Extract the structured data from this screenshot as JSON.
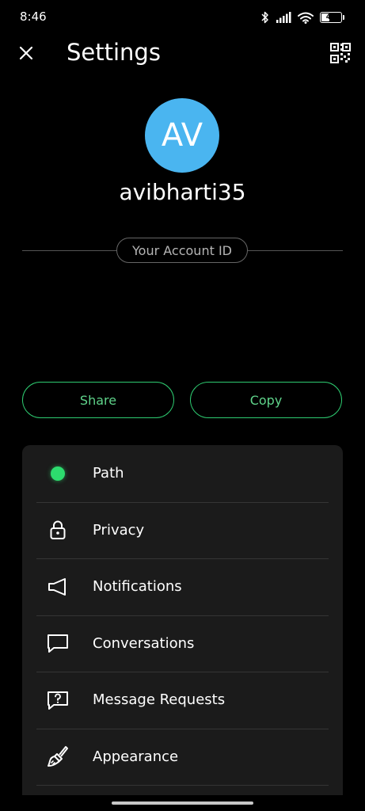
{
  "status_bar": {
    "time": "8:46",
    "battery": "43",
    "battery_level": 0.43
  },
  "header": {
    "title": "Settings"
  },
  "profile": {
    "initials": "AV",
    "username": "avibharti35",
    "account_id_label": "Your Account ID",
    "avatar_color": "#4ab5f0"
  },
  "actions": {
    "share_label": "Share",
    "copy_label": "Copy",
    "accent_color": "#2ecc71"
  },
  "menu": {
    "items": [
      {
        "label": "Path",
        "icon": "status-dot-icon"
      },
      {
        "label": "Privacy",
        "icon": "lock-icon"
      },
      {
        "label": "Notifications",
        "icon": "speaker-icon"
      },
      {
        "label": "Conversations",
        "icon": "chat-bubble-icon"
      },
      {
        "label": "Message Requests",
        "icon": "question-bubble-icon"
      },
      {
        "label": "Appearance",
        "icon": "paintbrush-icon"
      }
    ]
  }
}
